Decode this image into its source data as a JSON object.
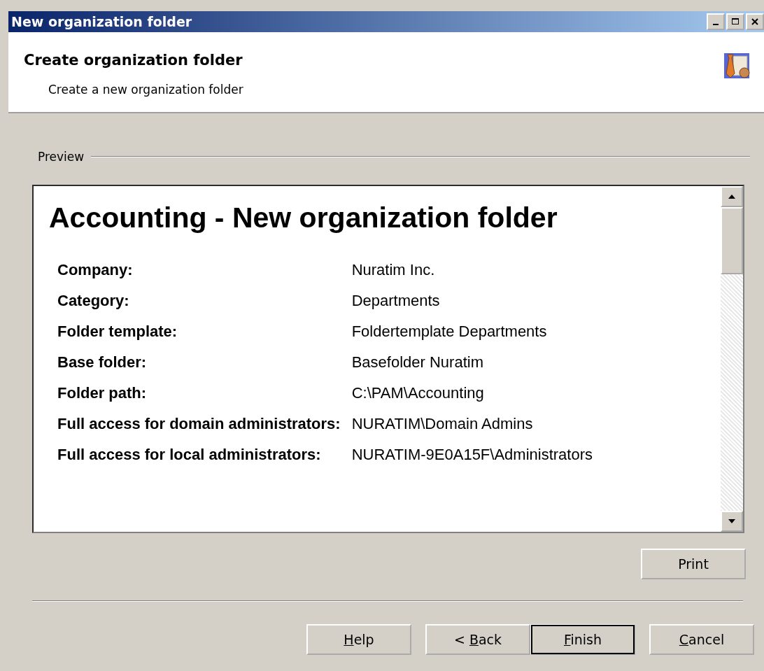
{
  "window": {
    "title": "New organization folder"
  },
  "header": {
    "title": "Create organization folder",
    "subtitle": "Create a new organization folder"
  },
  "preview": {
    "label": "Preview",
    "heading": "Accounting - New organization folder",
    "rows": [
      {
        "label": "Company:",
        "value": "Nuratim Inc."
      },
      {
        "label": "Category:",
        "value": "Departments"
      },
      {
        "label": "Folder template:",
        "value": "Foldertemplate Departments"
      },
      {
        "label": "Base folder:",
        "value": "Basefolder Nuratim"
      },
      {
        "label": "Folder path:",
        "value": "C:\\PAM\\Accounting"
      },
      {
        "label": "Full access for domain administrators:",
        "value": "NURATIM\\Domain Admins"
      },
      {
        "label": "Full access for local administrators:",
        "value": "NURATIM-9E0A15F\\Administrators"
      }
    ]
  },
  "print_button": {
    "after": "Print"
  },
  "buttons": [
    {
      "key": "H",
      "after": "elp",
      "default": false
    },
    {
      "before": "< ",
      "key": "B",
      "after": "ack",
      "default": false
    },
    {
      "key": "F",
      "after": "inish",
      "default": true
    },
    {
      "key": "C",
      "after": "ancel",
      "default": false
    }
  ]
}
